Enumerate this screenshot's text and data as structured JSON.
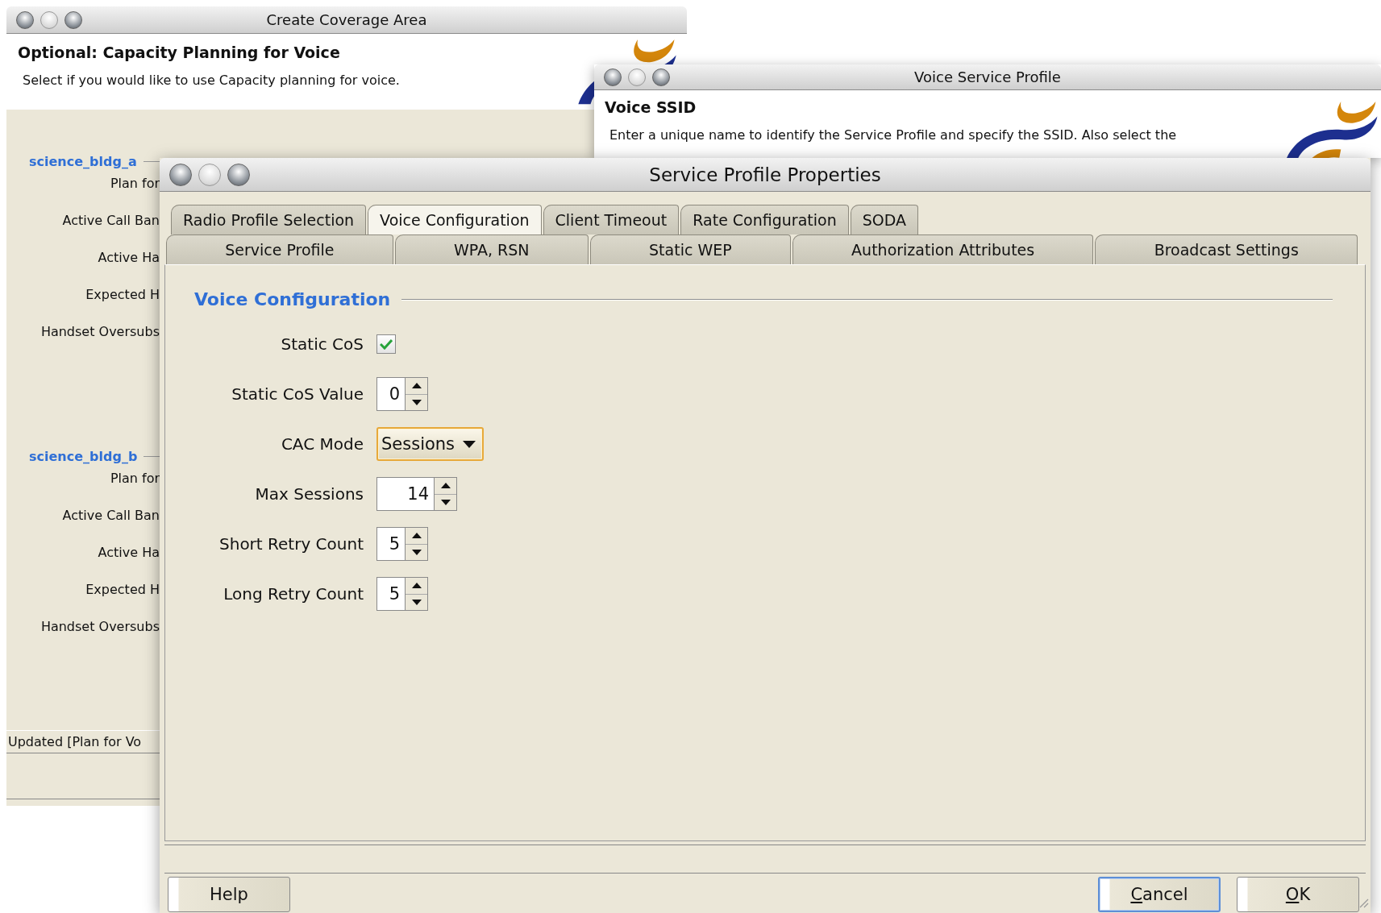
{
  "coverage_window": {
    "title": "Create Coverage Area",
    "heading": "Optional: Capacity Planning for Voice",
    "description": "Select if you would like to use Capacity planning for voice.",
    "groups": [
      {
        "name": "science_bldg_a",
        "labels": [
          "Plan for",
          "Active Call Ban",
          "Active Ha",
          "Expected H",
          "Handset Oversubs"
        ]
      },
      {
        "name": "science_bldg_b",
        "labels": [
          "Plan for",
          "Active Call Ban",
          "Active Ha",
          "Expected H",
          "Handset Oversubs"
        ]
      }
    ],
    "status": "Updated [Plan for Vo"
  },
  "voice_profile_window": {
    "title": "Voice Service Profile",
    "heading": "Voice SSID",
    "description": "Enter a unique name to identify the Service Profile and specify the SSID.  Also select the"
  },
  "properties_window": {
    "title": "Service Profile Properties",
    "tab_rows": [
      [
        {
          "label": "Radio Profile Selection",
          "selected": false
        },
        {
          "label": "Voice Configuration",
          "selected": true
        },
        {
          "label": "Client Timeout",
          "selected": false
        },
        {
          "label": "Rate Configuration",
          "selected": false
        },
        {
          "label": "SODA",
          "selected": false
        }
      ],
      [
        {
          "label": "Service Profile",
          "selected": false
        },
        {
          "label": "WPA, RSN",
          "selected": false
        },
        {
          "label": "Static WEP",
          "selected": false
        },
        {
          "label": "Authorization Attributes",
          "selected": false
        },
        {
          "label": "Broadcast Settings",
          "selected": false
        }
      ]
    ],
    "section_title": "Voice Configuration",
    "fields": [
      {
        "kind": "checkbox",
        "label": "Static CoS",
        "checked": true
      },
      {
        "kind": "spinner",
        "label": "Static CoS Value",
        "value": "0"
      },
      {
        "kind": "dropdown",
        "label": "CAC Mode",
        "value": "Sessions"
      },
      {
        "kind": "spinner",
        "label": "Max Sessions",
        "value": "14"
      },
      {
        "kind": "spinner",
        "label": "Short Retry Count",
        "value": "5"
      },
      {
        "kind": "spinner",
        "label": "Long Retry Count",
        "value": "5"
      }
    ],
    "buttons": [
      {
        "label": "Help",
        "focused": false,
        "underline_first": false
      },
      {
        "label": "Cancel",
        "focused": true,
        "underline_first": true
      },
      {
        "label": "OK",
        "focused": false,
        "underline_first": true
      }
    ]
  }
}
